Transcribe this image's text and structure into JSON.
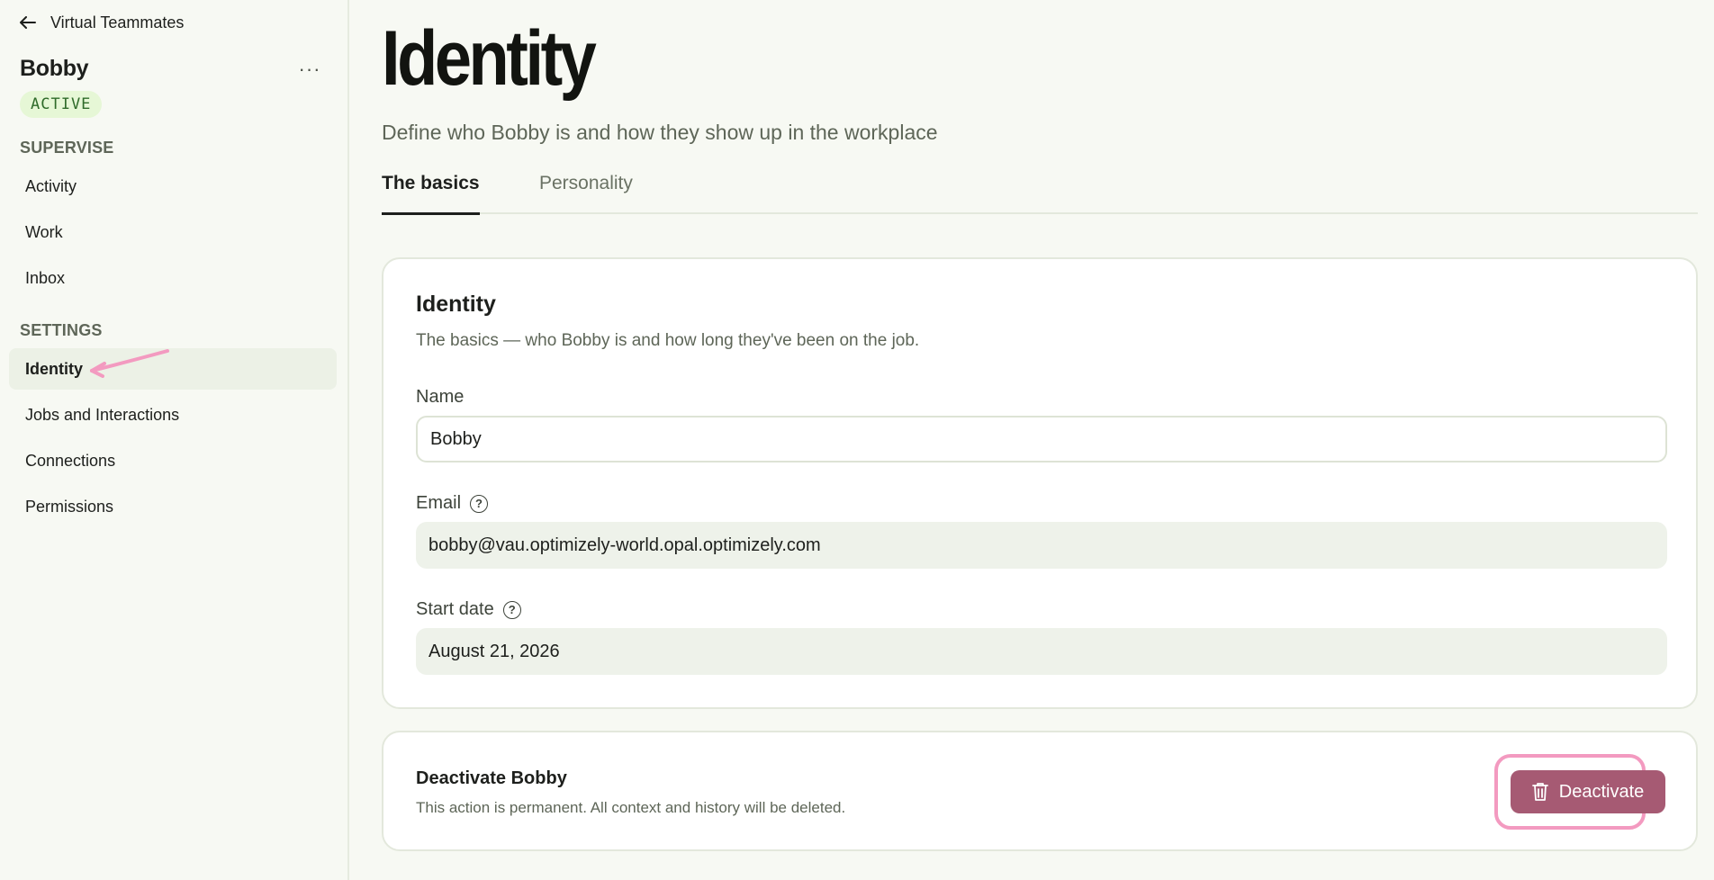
{
  "sidebar": {
    "back_label": "Virtual Teammates",
    "agent_name": "Bobby",
    "more_label": "···",
    "status": "ACTIVE",
    "sections": [
      {
        "label": "SUPERVISE",
        "items": [
          {
            "label": "Activity"
          },
          {
            "label": "Work"
          },
          {
            "label": "Inbox"
          }
        ]
      },
      {
        "label": "SETTINGS",
        "items": [
          {
            "label": "Identity",
            "active": true
          },
          {
            "label": "Jobs and Interactions"
          },
          {
            "label": "Connections"
          },
          {
            "label": "Permissions"
          }
        ]
      }
    ]
  },
  "header": {
    "title": "Identity",
    "subtitle": "Define who Bobby is and how they show up in the workplace"
  },
  "tabs": [
    {
      "label": "The basics",
      "active": true
    },
    {
      "label": "Personality"
    }
  ],
  "identity_card": {
    "title": "Identity",
    "description": "The basics — who Bobby is and how long they've been on the job.",
    "name_label": "Name",
    "name_value": "Bobby",
    "email_label": "Email",
    "email_value": "bobby@vau.optimizely-world.opal.optimizely.com",
    "start_date_label": "Start date",
    "start_date_value": "August 21, 2026",
    "help_icon": "question-circle-icon"
  },
  "danger_card": {
    "title": "Deactivate Bobby",
    "description": "This action is permanent. All context and history will be deleted.",
    "button_label": "Deactivate",
    "button_icon": "trash-icon"
  },
  "colors": {
    "background": "#f7f9f3",
    "badge_bg": "#e6f7d6",
    "badge_text": "#2f6b2a",
    "danger_button": "#a65a73",
    "annotation": "#f39ac0"
  }
}
